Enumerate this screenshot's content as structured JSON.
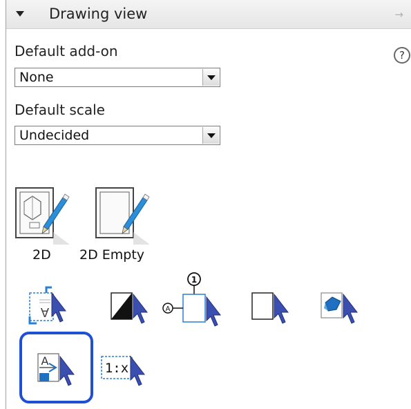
{
  "panel": {
    "title": "Drawing view",
    "pin_glyph": "→",
    "help_glyph": "?"
  },
  "default_addon": {
    "label": "Default add-on",
    "value": "None"
  },
  "default_scale": {
    "label": "Default scale",
    "value": "Undecided"
  },
  "templates": [
    {
      "label": "2D",
      "icon": "drawing-2d-icon"
    },
    {
      "label": "2D Empty",
      "icon": "drawing-2d-empty-icon"
    }
  ],
  "tools": {
    "balloon_number": "1",
    "balloon_letter": "A",
    "scale_text": "1:x",
    "annotation_letter": "A"
  },
  "colors": {
    "accent": "#1e50d4",
    "pencil": "#2a8fd8",
    "cursor": "#3a4fb0",
    "frame": "#2a7fd4"
  }
}
